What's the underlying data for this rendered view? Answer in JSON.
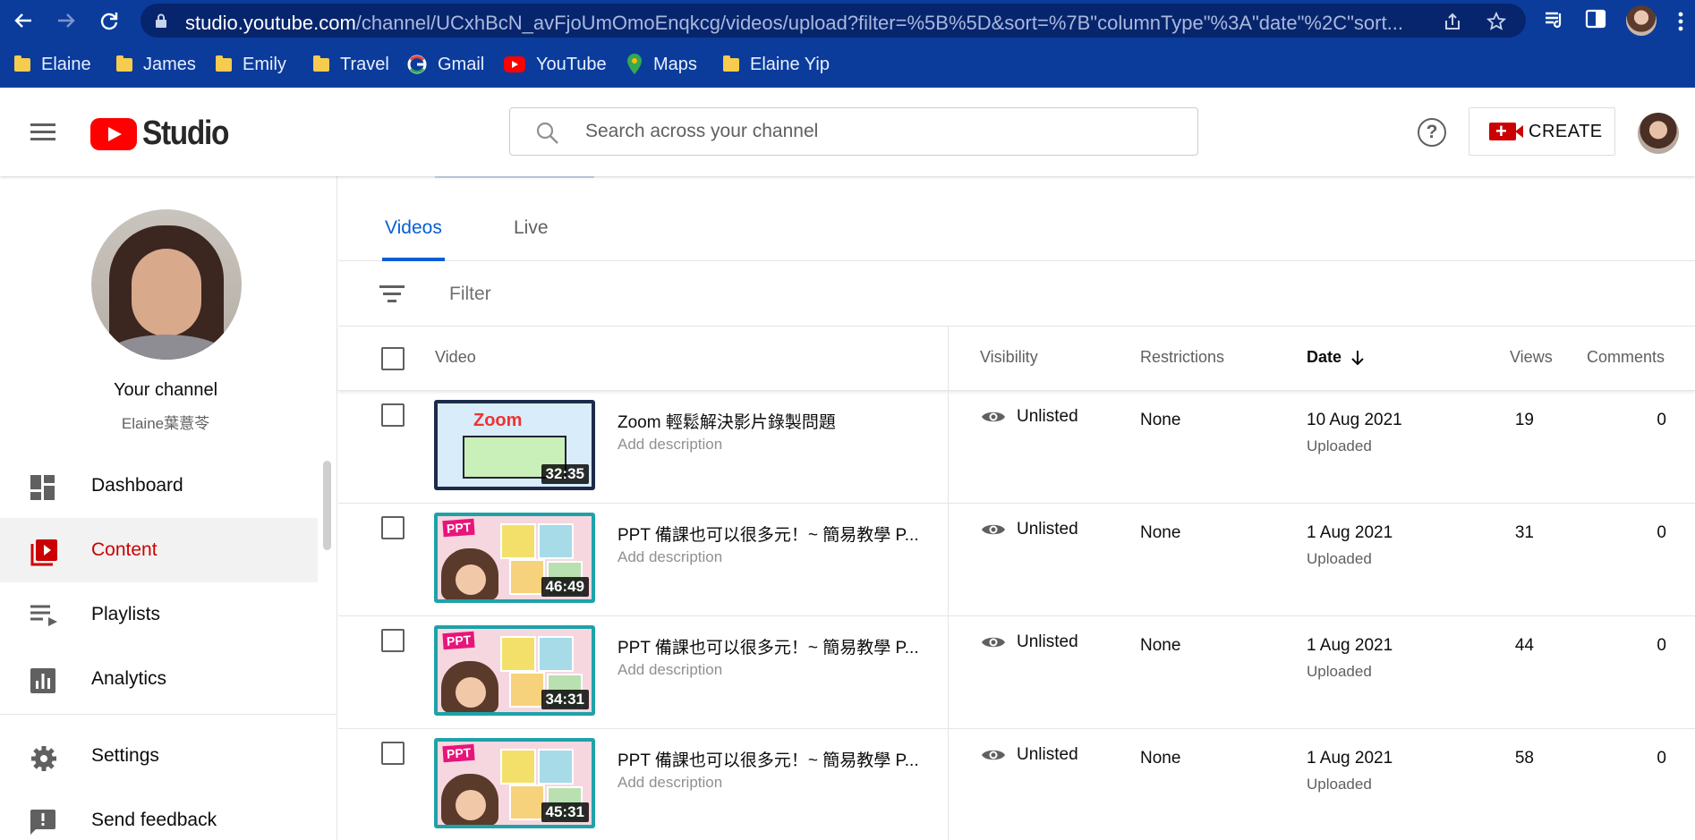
{
  "browser": {
    "url_main": "studio.youtube.com",
    "url_rest": "/channel/UCxhBcN_avFjoUmOmoEnqkcg/videos/upload?filter=%5B%5D&sort=%7B\"columnType\"%3A\"date\"%2C\"sort...",
    "bookmarks": [
      {
        "label": "Elaine",
        "icon": "folder-icon"
      },
      {
        "label": "James",
        "icon": "folder-icon"
      },
      {
        "label": "Emily",
        "icon": "folder-icon"
      },
      {
        "label": "Travel",
        "icon": "folder-icon"
      },
      {
        "label": "Gmail",
        "icon": "google-icon"
      },
      {
        "label": "YouTube",
        "icon": "youtube-icon"
      },
      {
        "label": "Maps",
        "icon": "maps-icon"
      },
      {
        "label": "Elaine Yip",
        "icon": "folder-icon"
      }
    ]
  },
  "header": {
    "logo_text": "Studio",
    "search_placeholder": "Search across your channel",
    "create_label": "CREATE"
  },
  "sidebar": {
    "your_channel": "Your channel",
    "channel_name": "Elaine葉薏苓",
    "items": [
      {
        "label": "Dashboard",
        "icon": "dashboard-icon"
      },
      {
        "label": "Content",
        "icon": "content-icon",
        "active": true
      },
      {
        "label": "Playlists",
        "icon": "playlists-icon"
      },
      {
        "label": "Analytics",
        "icon": "analytics-icon"
      },
      {
        "label": "Settings",
        "icon": "settings-icon"
      },
      {
        "label": "Send feedback",
        "icon": "feedback-icon"
      }
    ]
  },
  "tabs": [
    {
      "label": "Videos",
      "active": true
    },
    {
      "label": "Live"
    }
  ],
  "filter_placeholder": "Filter",
  "table": {
    "headers": {
      "video": "Video",
      "visibility": "Visibility",
      "restrictions": "Restrictions",
      "date": "Date",
      "views": "Views",
      "comments": "Comments"
    },
    "rows": [
      {
        "title": "Zoom 輕鬆解決影片錄製問題",
        "description": "Add description",
        "duration": "32:35",
        "visibility": "Unlisted",
        "restrictions": "None",
        "date": "10 Aug 2021",
        "date_status": "Uploaded",
        "views": "19",
        "comments": "0",
        "thumb_type": "zoom"
      },
      {
        "title": "PPT 備課也可以很多元！~ 簡易教學 P...",
        "description": "Add description",
        "duration": "46:49",
        "visibility": "Unlisted",
        "restrictions": "None",
        "date": "1 Aug 2021",
        "date_status": "Uploaded",
        "views": "31",
        "comments": "0",
        "thumb_type": "ppt"
      },
      {
        "title": "PPT 備課也可以很多元！~ 簡易教學 P...",
        "description": "Add description",
        "duration": "34:31",
        "visibility": "Unlisted",
        "restrictions": "None",
        "date": "1 Aug 2021",
        "date_status": "Uploaded",
        "views": "44",
        "comments": "0",
        "thumb_type": "ppt"
      },
      {
        "title": "PPT 備課也可以很多元！~ 簡易教學 P...",
        "description": "Add description",
        "duration": "45:31",
        "visibility": "Unlisted",
        "restrictions": "None",
        "date": "1 Aug 2021",
        "date_status": "Uploaded",
        "views": "58",
        "comments": "0",
        "thumb_type": "ppt"
      }
    ]
  },
  "colors": {
    "browser_bar": "#0b3c9c",
    "accent_red": "#cc0000",
    "tab_blue": "#065fd4"
  }
}
